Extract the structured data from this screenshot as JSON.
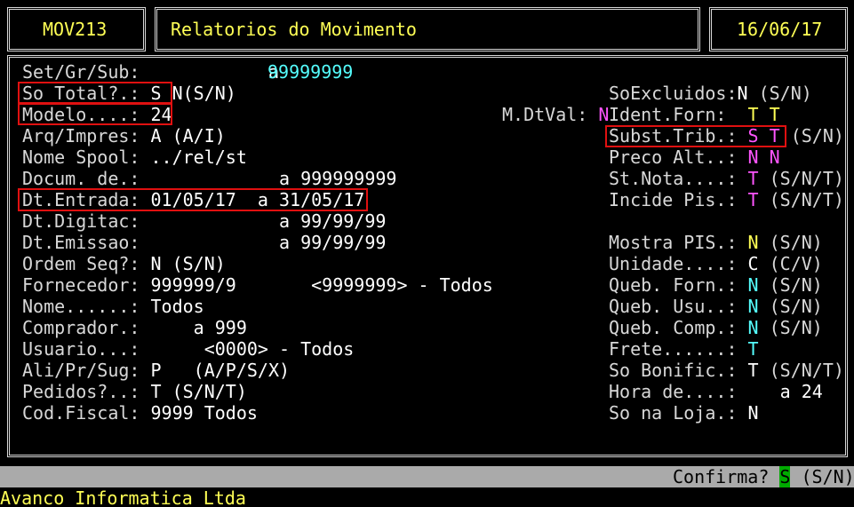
{
  "header": {
    "program": "MOV213",
    "title": "Relatorios do Movimento",
    "date": "16/06/17"
  },
  "left": [
    {
      "label": "Set/Gr/Sub:",
      "text": "            a "
    },
    {
      "label": "So Total?.:",
      "text": " S N(S/N)"
    },
    {
      "label": "Modelo....:",
      "text": " 24"
    },
    {
      "label": "Arq/Impres:",
      "text": " A (A/I)"
    },
    {
      "label": "Nome Spool:",
      "text": " ../rel/st"
    },
    {
      "label": "Docum. de.:",
      "text": "             a 999999999"
    },
    {
      "label": "Dt.Entrada:",
      "text": " 01/05/17  a 31/05/17"
    },
    {
      "label": "Dt.Digitac:",
      "text": "             a 99/99/99"
    },
    {
      "label": "Dt.Emissao:",
      "text": "             a 99/99/99"
    },
    {
      "label": "Ordem Seq?:",
      "text": " N (S/N)"
    },
    {
      "label": "Fornecedor:",
      "text": " 999999/9       <9999999> - Todos"
    },
    {
      "label": "Nome......:",
      "text": " Todos"
    },
    {
      "label": "Comprador.:",
      "text": "     a 999"
    },
    {
      "label": "Usuario...:",
      "text": "      <0000> - Todos"
    },
    {
      "label": "Ali/Pr/Sug:",
      "text": " P   (A/P/S/X)"
    },
    {
      "label": "Pedidos?..:",
      "text": " T (S/N/T)"
    },
    {
      "label": "Cod.Fiscal:",
      "text": " 9999 Todos"
    }
  ],
  "setgr_value": "99999999",
  "mdtval": {
    "label": "M.DtVal:",
    "value": "N"
  },
  "right": [
    {
      "label": "SoExcluidos:",
      "value": "N",
      "hint": " (S/N)",
      "color": "plain"
    },
    {
      "label": "Ident.Forn: ",
      "value": " T T",
      "hint": "",
      "color": "yellow"
    },
    {
      "label": "Subst.Trib.:",
      "value": " S T",
      "hint": " (S/N)",
      "color": "magenta"
    },
    {
      "label": "Preco Alt..:",
      "value": " N N",
      "hint": "",
      "color": "magenta"
    },
    {
      "label": "St.Nota....:",
      "value": " T",
      "hint": " (S/N/T)",
      "color": "magenta"
    },
    {
      "label": "Incide Pis.:",
      "value": " T",
      "hint": " (S/N/T)",
      "color": "magenta"
    },
    {
      "label": "",
      "value": "",
      "hint": "",
      "color": "plain"
    },
    {
      "label": "Mostra PIS.:",
      "value": " N",
      "hint": " (S/N)",
      "color": "yellow"
    },
    {
      "label": "Unidade....:",
      "value": " C",
      "hint": " (C/V)",
      "color": "plain"
    },
    {
      "label": "Queb. Forn.:",
      "value": " N",
      "hint": " (S/N)",
      "color": "cyan"
    },
    {
      "label": "Queb. Usu..:",
      "value": " N",
      "hint": " (S/N)",
      "color": "cyan"
    },
    {
      "label": "Queb. Comp.:",
      "value": " N",
      "hint": " (S/N)",
      "color": "cyan"
    },
    {
      "label": "Frete......:",
      "value": " T",
      "hint": "",
      "color": "cyan"
    },
    {
      "label": "So Bonific.:",
      "value": " T",
      "hint": " (S/N/T)",
      "color": "plain"
    },
    {
      "label": "Hora de....:",
      "value": "    a 24",
      "hint": "",
      "color": "plain"
    },
    {
      "label": "So na Loja.:",
      "value": " N",
      "hint": "",
      "color": "plain"
    }
  ],
  "status": {
    "prompt": "Confirma? ",
    "value": "S",
    "hint": " (S/N)"
  },
  "footer": "Avanco Informatica Ltda",
  "colors": {
    "background": "#000000",
    "text": "#d8d8d8",
    "yellow": "#ffff55",
    "cyan": "#55ffff",
    "magenta": "#ff55ff",
    "highlight": "#e01010",
    "statusbar": "#aaaaaa",
    "confirm": "#00aa00"
  }
}
